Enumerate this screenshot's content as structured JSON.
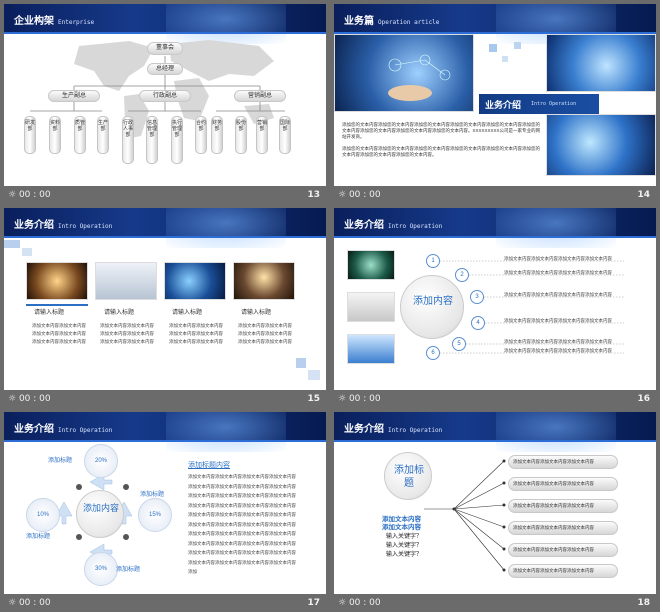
{
  "footer_time": "00 : 00",
  "slides": {
    "s13": {
      "number": "13",
      "title": "企业构架",
      "subtitle": "Enterprise",
      "top": [
        "董事会",
        "总经理"
      ],
      "mids": [
        "生产副总",
        "行政副总",
        "营销副总"
      ],
      "depts": [
        "研发部",
        "资料部",
        "质管部",
        "生产部",
        "行政人事部",
        "信息管理部",
        "执行管理部",
        "合约部",
        "财务部",
        "股份部",
        "营销部",
        "国际部"
      ]
    },
    "s14": {
      "number": "14",
      "title": "业务篇",
      "subtitle": "Operation article",
      "banner_title": "业务介绍",
      "banner_sub": "Intro Operation",
      "p1": "添加您的文本内容添加您的文本内容添加您的文本内容添加您的文本内容添加您的文本内容添加您的文本内容添加您的文本内容添加您的文本内容添加您的文本内容。XXXXXXXXX公司是一家专业的网站开发商。",
      "p2": "添加您的文本内容添加您的文本内容添加您的文本内容添加您的文本内容添加您的文本内容添加您的文本内容添加您的文本内容添加您的文本内容。"
    },
    "s15": {
      "number": "15",
      "title": "业务介绍",
      "subtitle": "Intro Operation",
      "items": [
        {
          "label": "请输入标题",
          "text": "添加文本内容添加文本内容添加文本内容添加文本内容添加文本内容添加文本内容"
        },
        {
          "label": "请输入标题",
          "text": "添加文本内容添加文本内容添加文本内容添加文本内容添加文本内容添加文本内容"
        },
        {
          "label": "请输入标题",
          "text": "添加文本内容添加文本内容添加文本内容添加文本内容添加文本内容添加文本内容"
        },
        {
          "label": "请输入标题",
          "text": "添加文本内容添加文本内容添加文本内容添加文本内容添加文本内容添加文本内容"
        }
      ]
    },
    "s16": {
      "number": "16",
      "title": "业务介绍",
      "subtitle": "Intro Operation",
      "center": "添加内容",
      "nodes": [
        "1",
        "2",
        "3",
        "4",
        "5",
        "6"
      ],
      "line_text": "添加文本内容添加文本内容添加文本内容添加文本内容"
    },
    "s17": {
      "number": "17",
      "title": "业务介绍",
      "subtitle": "Intro Operation",
      "center": "添加内容",
      "pcts": [
        "20%",
        "15%",
        "30%",
        "10%"
      ],
      "labels": [
        "添加标题",
        "添加标题",
        "添加标题",
        "添加标题"
      ],
      "right_title": "添加标题内容",
      "right_lines": [
        "添加文本内容添加文本内容添加文本内容添加文本内容",
        "添加文本内容添加文本内容添加文本内容添加文本内容",
        "添加文本内容添加文本内容添加文本内容添加文本内容",
        "添加文本内容添加文本内容添加文本内容添加文本内容",
        "添加文本内容添加文本内容添加文本内容添加文本内容",
        "添加文本内容添加文本内容添加文本内容添加文本内容",
        "添加文本内容添加文本内容添加文本内容添加文本内容",
        "添加文本内容添加文本内容添加文本内容添加文本内容",
        "添加文本内容添加文本内容添加文本内容添加文本内容",
        "添加文本内容添加文本内容添加文本内容添加文本内容",
        "添加"
      ]
    },
    "s18": {
      "number": "18",
      "title": "业务介绍",
      "subtitle": "Intro Operation",
      "center": "添加标题",
      "pills": [
        "添加文本内容添加文本内容添加文本内容",
        "添加文本内容添加文本内容添加文本内容",
        "添加文本内容添加文本内容添加文本内容",
        "添加文本内容添加文本内容添加文本内容",
        "添加文本内容添加文本内容添加文本内容",
        "添加文本内容添加文本内容添加文本内容"
      ],
      "left_blue": [
        "添加文本内容",
        "添加文本内容"
      ],
      "left_black": [
        "输入关键字？",
        "输入关键字？",
        "输入关键字？"
      ]
    }
  }
}
